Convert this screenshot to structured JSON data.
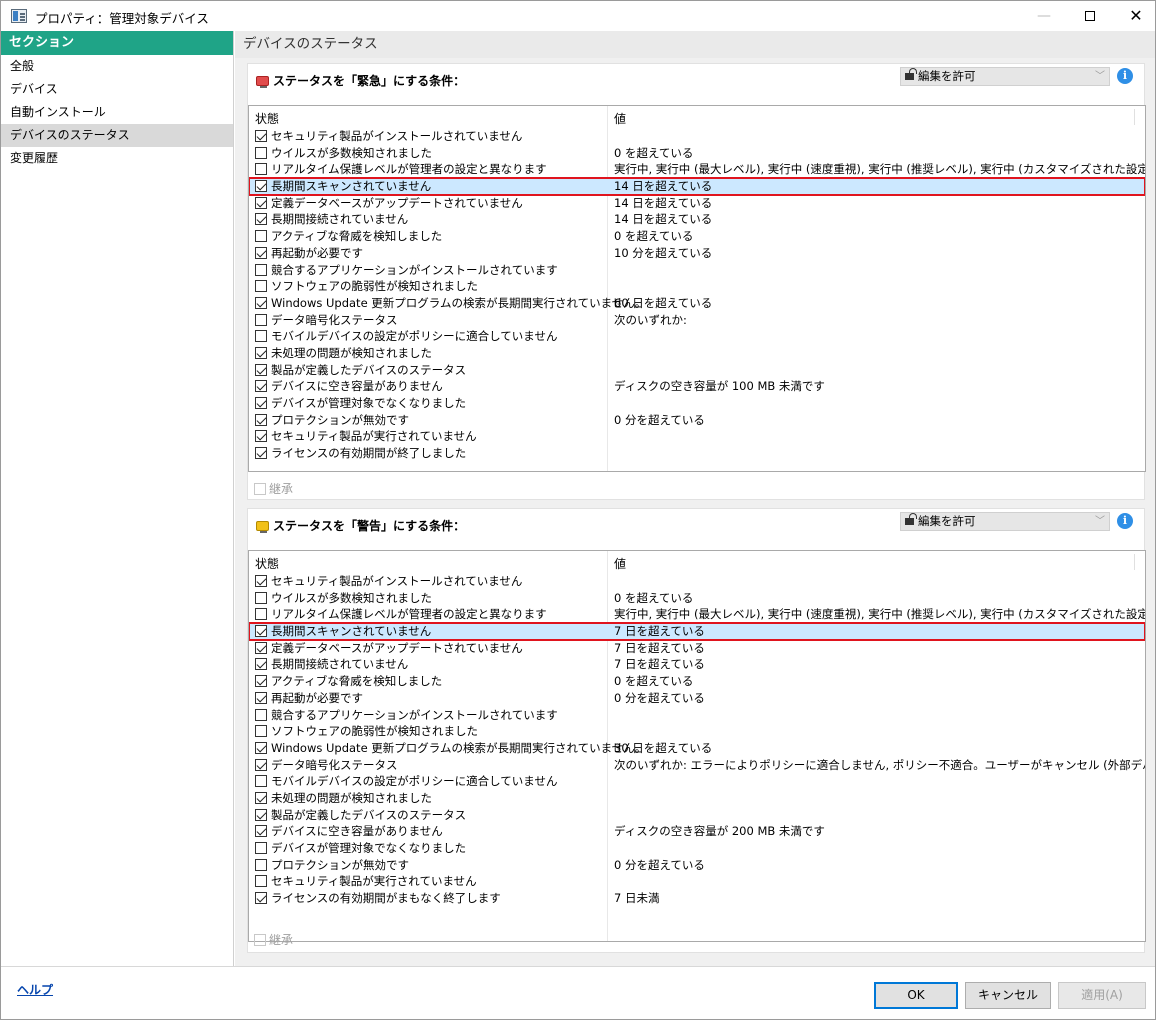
{
  "window": {
    "title": "プロパティ：管理対象デバイス"
  },
  "sidebar": {
    "header": "セクション",
    "items": [
      {
        "label": "全般",
        "selected": false
      },
      {
        "label": "デバイス",
        "selected": false
      },
      {
        "label": "自動インストール",
        "selected": false
      },
      {
        "label": "デバイスのステータス",
        "selected": true
      },
      {
        "label": "変更履歴",
        "selected": false
      }
    ]
  },
  "main": {
    "title": "デバイスのステータス"
  },
  "critical": {
    "title": "ステータスを「緊急」にする条件：",
    "permission": "編集を許可",
    "col_state": "状態",
    "col_value": "値",
    "inherit_label": "継承",
    "rows": [
      {
        "checked": true,
        "condition": "セキュリティ製品がインストールされていません",
        "value": ""
      },
      {
        "checked": false,
        "condition": "ウイルスが多数検知されました",
        "value": "0 を超えている"
      },
      {
        "checked": false,
        "condition": "リアルタイム保護レベルが管理者の設定と異なります",
        "value": "実行中, 実行中 (最大レベル), 実行中 (速度重視), 実行中 (推奨レベル), 実行中 (カスタマイズされた設定)"
      },
      {
        "checked": true,
        "condition": "長期間スキャンされていません",
        "value": "14 日を超えている",
        "highlight": true
      },
      {
        "checked": true,
        "condition": "定義データベースがアップデートされていません",
        "value": "14 日を超えている"
      },
      {
        "checked": true,
        "condition": "長期間接続されていません",
        "value": "14 日を超えている"
      },
      {
        "checked": false,
        "condition": "アクティブな脅威を検知しました",
        "value": "0 を超えている"
      },
      {
        "checked": true,
        "condition": "再起動が必要です",
        "value": "10 分を超えている"
      },
      {
        "checked": false,
        "condition": "競合するアプリケーションがインストールされています",
        "value": ""
      },
      {
        "checked": false,
        "condition": "ソフトウェアの脆弱性が検知されました",
        "value": ""
      },
      {
        "checked": true,
        "condition": "Windows Update 更新プログラムの検索が長期間実行されていません。",
        "value": "60 日を超えている"
      },
      {
        "checked": false,
        "condition": "データ暗号化ステータス",
        "value": "次のいずれか:"
      },
      {
        "checked": false,
        "condition": "モバイルデバイスの設定がポリシーに適合していません",
        "value": ""
      },
      {
        "checked": true,
        "condition": "未処理の問題が検知されました",
        "value": ""
      },
      {
        "checked": true,
        "condition": "製品が定義したデバイスのステータス",
        "value": ""
      },
      {
        "checked": true,
        "condition": "デバイスに空き容量がありません",
        "value": "ディスクの空き容量が 100 MB 未満です"
      },
      {
        "checked": true,
        "condition": "デバイスが管理対象でなくなりました",
        "value": ""
      },
      {
        "checked": true,
        "condition": "プロテクションが無効です",
        "value": "0 分を超えている"
      },
      {
        "checked": true,
        "condition": "セキュリティ製品が実行されていません",
        "value": ""
      },
      {
        "checked": true,
        "condition": "ライセンスの有効期間が終了しました",
        "value": ""
      }
    ]
  },
  "warning": {
    "title": "ステータスを「警告」にする条件：",
    "permission": "編集を許可",
    "col_state": "状態",
    "col_value": "値",
    "inherit_label": "継承",
    "rows": [
      {
        "checked": true,
        "condition": "セキュリティ製品がインストールされていません",
        "value": ""
      },
      {
        "checked": false,
        "condition": "ウイルスが多数検知されました",
        "value": "0 を超えている"
      },
      {
        "checked": false,
        "condition": "リアルタイム保護レベルが管理者の設定と異なります",
        "value": "実行中, 実行中 (最大レベル), 実行中 (速度重視), 実行中 (推奨レベル), 実行中 (カスタマイズされた設定)"
      },
      {
        "checked": true,
        "condition": "長期間スキャンされていません",
        "value": "7 日を超えている",
        "highlight": true
      },
      {
        "checked": true,
        "condition": "定義データベースがアップデートされていません",
        "value": "7 日を超えている"
      },
      {
        "checked": true,
        "condition": "長期間接続されていません",
        "value": "7 日を超えている"
      },
      {
        "checked": true,
        "condition": "アクティブな脅威を検知しました",
        "value": "0 を超えている"
      },
      {
        "checked": true,
        "condition": "再起動が必要です",
        "value": "0 分を超えている"
      },
      {
        "checked": false,
        "condition": "競合するアプリケーションがインストールされています",
        "value": ""
      },
      {
        "checked": false,
        "condition": "ソフトウェアの脆弱性が検知されました",
        "value": ""
      },
      {
        "checked": true,
        "condition": "Windows Update 更新プログラムの検索が長期間実行されていません。",
        "value": "30 日を超えている"
      },
      {
        "checked": true,
        "condition": "データ暗号化ステータス",
        "value": "次のいずれか: エラーによりポリシーに適合しません, ポリシー不適合。ユーザーがキャンセル (外部デバイスのみ)"
      },
      {
        "checked": false,
        "condition": "モバイルデバイスの設定がポリシーに適合していません",
        "value": ""
      },
      {
        "checked": true,
        "condition": "未処理の問題が検知されました",
        "value": ""
      },
      {
        "checked": true,
        "condition": "製品が定義したデバイスのステータス",
        "value": ""
      },
      {
        "checked": true,
        "condition": "デバイスに空き容量がありません",
        "value": "ディスクの空き容量が 200 MB 未満です"
      },
      {
        "checked": false,
        "condition": "デバイスが管理対象でなくなりました",
        "value": ""
      },
      {
        "checked": false,
        "condition": "プロテクションが無効です",
        "value": "0 分を超えている"
      },
      {
        "checked": false,
        "condition": "セキュリティ製品が実行されていません",
        "value": ""
      },
      {
        "checked": true,
        "condition": "ライセンスの有効期間がまもなく終了します",
        "value": "7 日未満"
      }
    ]
  },
  "footer": {
    "help": "ヘルプ",
    "ok": "OK",
    "cancel": "キャンセル",
    "apply": "適用(A)"
  },
  "colors": {
    "accent": "#1fa487",
    "highlight_border": "#e0141e",
    "highlight_bg": "#cce8ff"
  }
}
